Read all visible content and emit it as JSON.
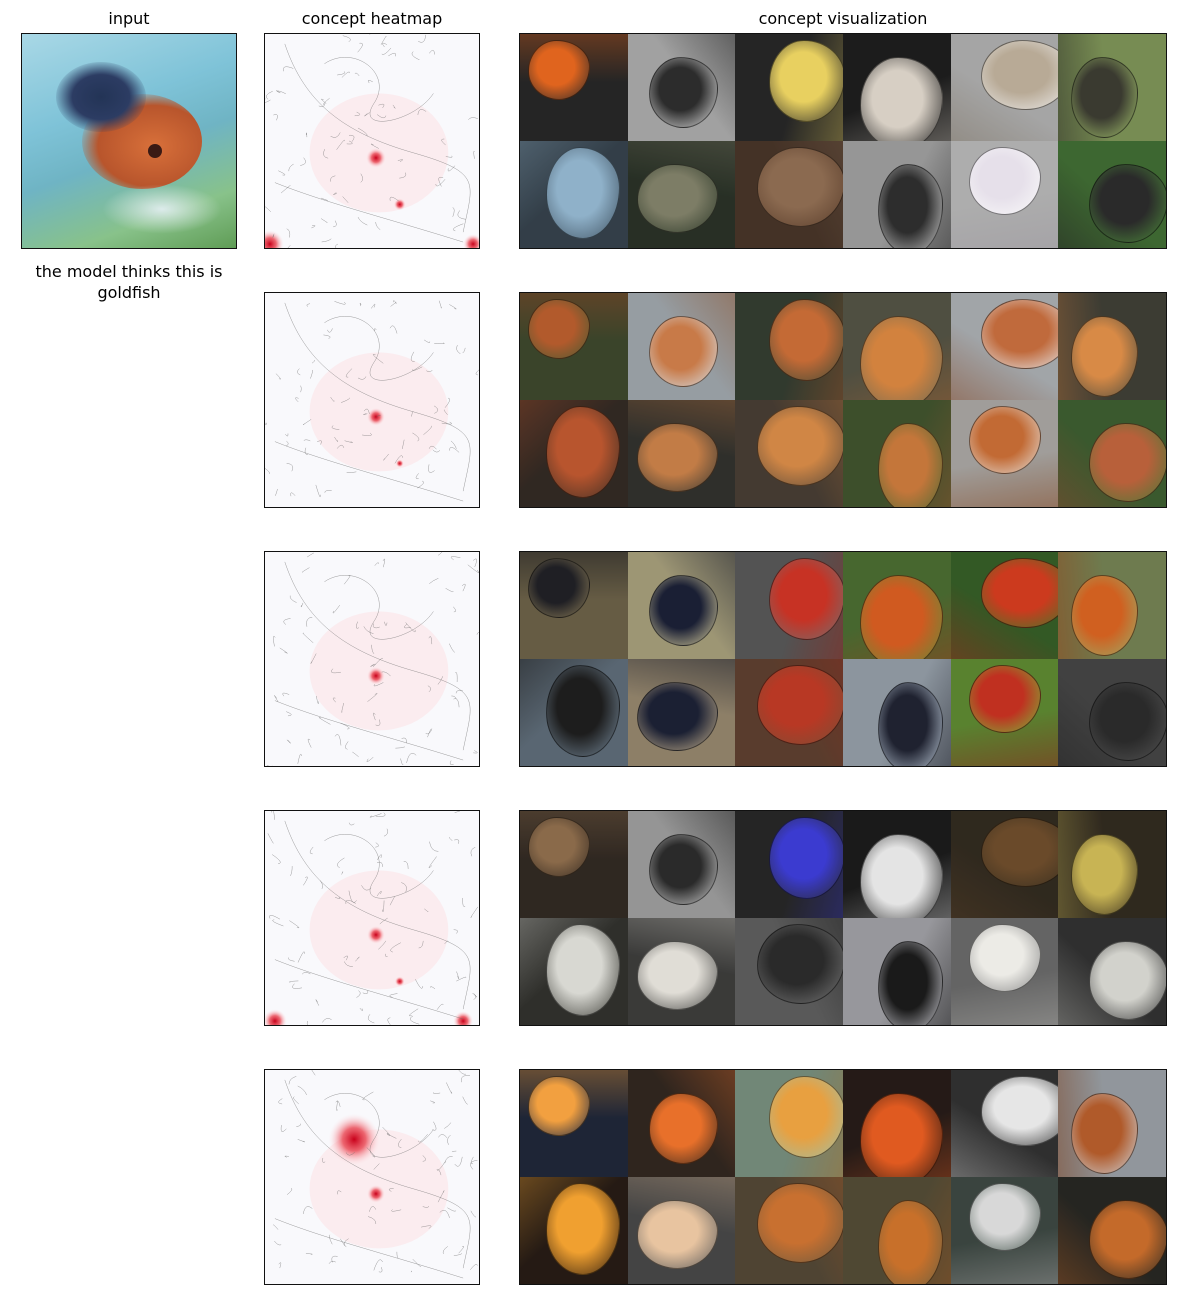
{
  "headers": {
    "input": "input",
    "heatmap": "concept heatmap",
    "visualization": "concept visualization"
  },
  "prediction_caption": "the model thinks this is goldfish",
  "concepts": [
    {
      "heat_spots": [
        [
          112,
          125,
          10
        ],
        [
          5,
          212,
          14
        ],
        [
          210,
          212,
          10
        ],
        [
          136,
          172,
          6
        ]
      ],
      "tiles": [
        [
          "#e0641e",
          "#2a2a2a"
        ],
        [
          "#2c2c2c",
          "#e9e9e9"
        ],
        [
          "#e8d060",
          "#2a2a2a"
        ],
        [
          "#d7cfc4",
          "#1d1d1d"
        ],
        [
          "#b8aa96",
          "#efefef"
        ],
        [
          "#3a3a30",
          "#a8c870"
        ],
        [
          "#8fb1c9",
          "#3f5160"
        ],
        [
          "#7d7d66",
          "#2e3a2a"
        ],
        [
          "#8b6a50",
          "#5a3e2c"
        ],
        [
          "#2d2d2d",
          "#d8d8d8"
        ],
        [
          "#e6e0ea",
          "#fafafa"
        ],
        [
          "#2a2a2a",
          "#4f8f3c"
        ]
      ]
    },
    {
      "heat_spots": [
        [
          112,
          125,
          9
        ],
        [
          136,
          172,
          4
        ]
      ],
      "tiles": [
        [
          "#b25a2c",
          "#4a5a32"
        ],
        [
          "#c87a48",
          "#d7e2ea"
        ],
        [
          "#c46a35",
          "#3c4a38"
        ],
        [
          "#d2823e",
          "#6a6a55"
        ],
        [
          "#c06a3c",
          "#e8eef3"
        ],
        [
          "#d88a46",
          "#4d4d40"
        ],
        [
          "#b8552e",
          "#3b2e25"
        ],
        [
          "#c27c46",
          "#3a3a34"
        ],
        [
          "#d08645",
          "#5a4b3c"
        ],
        [
          "#c4763a",
          "#4f6a34"
        ],
        [
          "#c26a34",
          "#e6e2dd"
        ],
        [
          "#b8603a",
          "#4a7a38"
        ]
      ]
    },
    {
      "heat_spots": [
        [
          112,
          125,
          9
        ]
      ],
      "tiles": [
        [
          "#1f1f24",
          "#8e7f5a"
        ],
        [
          "#1a1f34",
          "#e2d7a4"
        ],
        [
          "#c73224",
          "#707070"
        ],
        [
          "#d05a20",
          "#5f8f3a"
        ],
        [
          "#cc3a1e",
          "#3f7a2a"
        ],
        [
          "#d06020",
          "#9aae6a"
        ],
        [
          "#1d1d1d",
          "#7a8ea0"
        ],
        [
          "#1b2033",
          "#c9b490"
        ],
        [
          "#b83824",
          "#7a4e36"
        ],
        [
          "#1f2230",
          "#c8d6e4"
        ],
        [
          "#c03020",
          "#7ab83a"
        ],
        [
          "#2a2a2a",
          "#555555"
        ]
      ]
    },
    {
      "heat_spots": [
        [
          112,
          125,
          9
        ],
        [
          136,
          172,
          5
        ],
        [
          10,
          212,
          12
        ],
        [
          200,
          212,
          10
        ]
      ],
      "tiles": [
        [
          "#8a6a4a",
          "#3a2e24"
        ],
        [
          "#2a2a2a",
          "#d6d6d6"
        ],
        [
          "#3b3bd0",
          "#2a2a2a"
        ],
        [
          "#e4e4e4",
          "#1a1a1a"
        ],
        [
          "#6a4a2a",
          "#3a3020"
        ],
        [
          "#c8b454",
          "#3a3020"
        ],
        [
          "#d8d8d2",
          "#3a3a34"
        ],
        [
          "#e0ddd6",
          "#4a4a48"
        ],
        [
          "#2a2a2a",
          "#7a7a7a"
        ],
        [
          "#1a1a1a",
          "#d9d9e0"
        ],
        [
          "#ecebe6",
          "#8a8a8a"
        ],
        [
          "#d2d2cc",
          "#3a3a3a"
        ]
      ]
    },
    {
      "heat_spots": [
        [
          112,
          125,
          9
        ],
        [
          90,
          70,
          26
        ]
      ],
      "tiles": [
        [
          "#f2a040",
          "#1f2a44"
        ],
        [
          "#e8702a",
          "#3a2a20"
        ],
        [
          "#e8a040",
          "#9ec0a8"
        ],
        [
          "#e05a20",
          "#2a1a14"
        ],
        [
          "#e6e6e6",
          "#3a3a3a"
        ],
        [
          "#b05a2a",
          "#cfd8e0"
        ],
        [
          "#f0a030",
          "#2a1a10"
        ],
        [
          "#e8c4a0",
          "#5a5a5a"
        ],
        [
          "#c87030",
          "#6a5a40"
        ],
        [
          "#c8702a",
          "#6a6040"
        ],
        [
          "#d8d8d8",
          "#4a5a52"
        ],
        [
          "#c46a2a",
          "#2a2a24"
        ]
      ]
    }
  ]
}
